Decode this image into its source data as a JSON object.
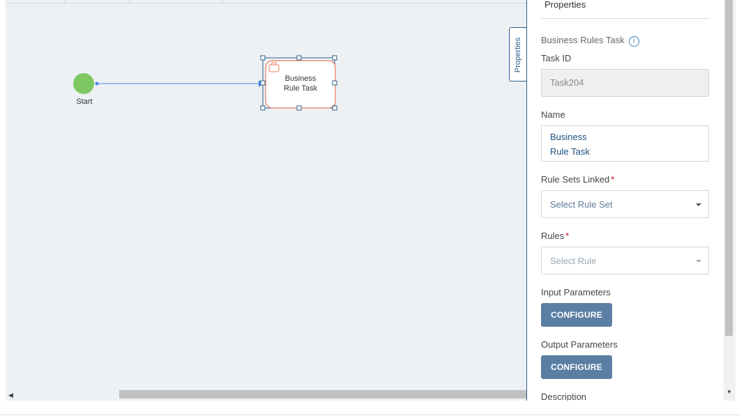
{
  "diagram": {
    "start_label": "Start",
    "task_label_line1": "Business",
    "task_label_line2": "Rule Task"
  },
  "properties_tab": {
    "label": "Properties"
  },
  "panel": {
    "title": "Properties",
    "section_title": "Business Rules Task",
    "task_id_label": "Task ID",
    "task_id_value": "Task204",
    "name_label": "Name",
    "name_line1": "Business",
    "name_line2": "Rule Task",
    "rule_sets_label": "Rule Sets Linked",
    "rule_sets_placeholder": "Select Rule Set",
    "rules_label": "Rules",
    "rules_placeholder": "Select Rule",
    "required_mark": "*",
    "input_params_label": "Input Parameters",
    "input_configure": "CONFIGURE",
    "output_params_label": "Output Parameters",
    "output_configure": "CONFIGURE",
    "description_label": "Description"
  },
  "icons": {
    "info": "i"
  },
  "colors": {
    "accent": "#2a5d8a",
    "start_event": "#7ec864",
    "task_border": "#e8795a",
    "button": "#5b7fa3",
    "required": "#d0021b"
  }
}
